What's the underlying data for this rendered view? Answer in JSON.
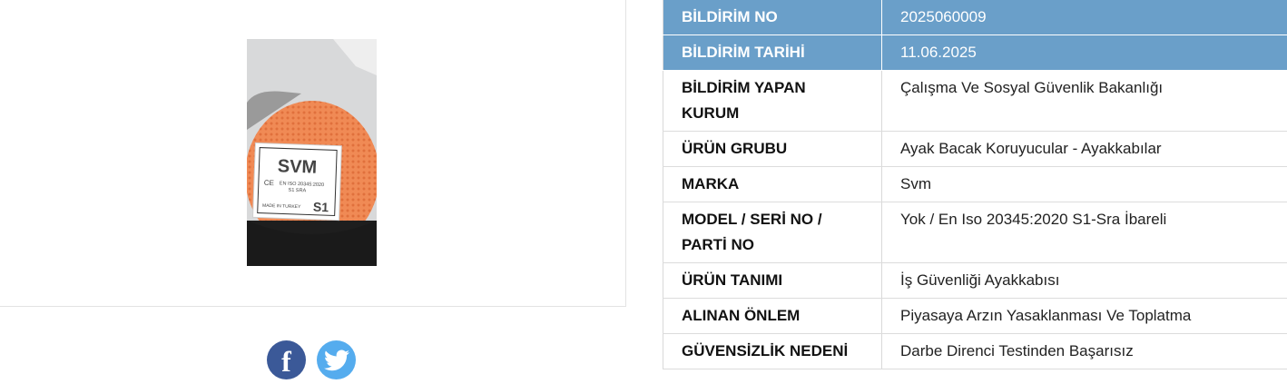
{
  "photo": {
    "label_brand": "SVM",
    "label_ce": "CE",
    "label_standard": "EN ISO 20345:2020",
    "label_class": "S1 SRA",
    "label_origin": "MADE IN TURKEY",
    "label_grade": "S1"
  },
  "share": {
    "facebook_icon": "f",
    "colors": {
      "facebook": "#3b5998",
      "twitter": "#55acee"
    }
  },
  "details": {
    "header_color": "#6a9fc9",
    "rows": [
      {
        "key": "BİLDİRİM NO",
        "value": "2025060009"
      },
      {
        "key": "BİLDİRİM TARİHİ",
        "value": "11.06.2025"
      },
      {
        "key": "BİLDİRİM YAPAN KURUM",
        "value": "Çalışma Ve Sosyal Güvenlik Bakanlığı"
      },
      {
        "key": "ÜRÜN GRUBU",
        "value": "Ayak Bacak Koruyucular - Ayakkabılar"
      },
      {
        "key": "MARKA",
        "value": "Svm"
      },
      {
        "key": "MODEL / SERİ NO / PARTİ NO",
        "value": "Yok / En Iso 20345:2020 S1-Sra İbareli"
      },
      {
        "key": "ÜRÜN TANIMI",
        "value": "İş Güvenliği Ayakkabısı"
      },
      {
        "key": "ALINAN ÖNLEM",
        "value": "Piyasaya Arzın Yasaklanması Ve Toplatma"
      },
      {
        "key": "GÜVENSİZLİK NEDENİ",
        "value": "Darbe Direnci Testinden Başarısız"
      }
    ]
  }
}
